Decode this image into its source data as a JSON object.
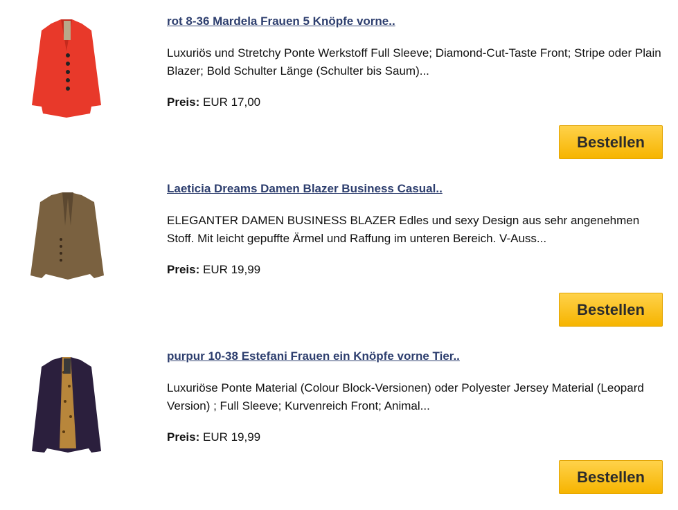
{
  "products": [
    {
      "title": "rot 8-36 Mardela Frauen 5 Knöpfe vorne..",
      "description": "Luxuriös und Stretchy Ponte Werkstoff Full Sleeve; Diamond-Cut-Taste Front; Stripe oder Plain Blazer; Bold Schulter Länge (Schulter bis Saum)...",
      "price_label": "Preis:",
      "price": "EUR 17,00",
      "button": "Bestellen",
      "image_icon": "red-blazer-image",
      "color": "#e8392a"
    },
    {
      "title": "Laeticia Dreams Damen Blazer Business Casual..",
      "description": "ELEGANTER DAMEN BUSINESS BLAZER Edles und sexy Design aus sehr angenehmen Stoff. Mit leicht gepuffte Ärmel und Raffung im unteren Bereich. V-Auss...",
      "price_label": "Preis:",
      "price": "EUR 19,99",
      "button": "Bestellen",
      "image_icon": "brown-blazer-image",
      "color": "#7a6140"
    },
    {
      "title": "purpur 10-38 Estefani Frauen ein Knöpfe vorne Tier..",
      "description": "Luxuriöse Ponte Material (Colour Block-Versionen) oder Polyester Jersey Material (Leopard Version) ; Full Sleeve; Kurvenreich Front; Animal...",
      "price_label": "Preis:",
      "price": "EUR 19,99",
      "button": "Bestellen",
      "image_icon": "purple-blazer-image",
      "color": "#2b1f3d"
    }
  ]
}
